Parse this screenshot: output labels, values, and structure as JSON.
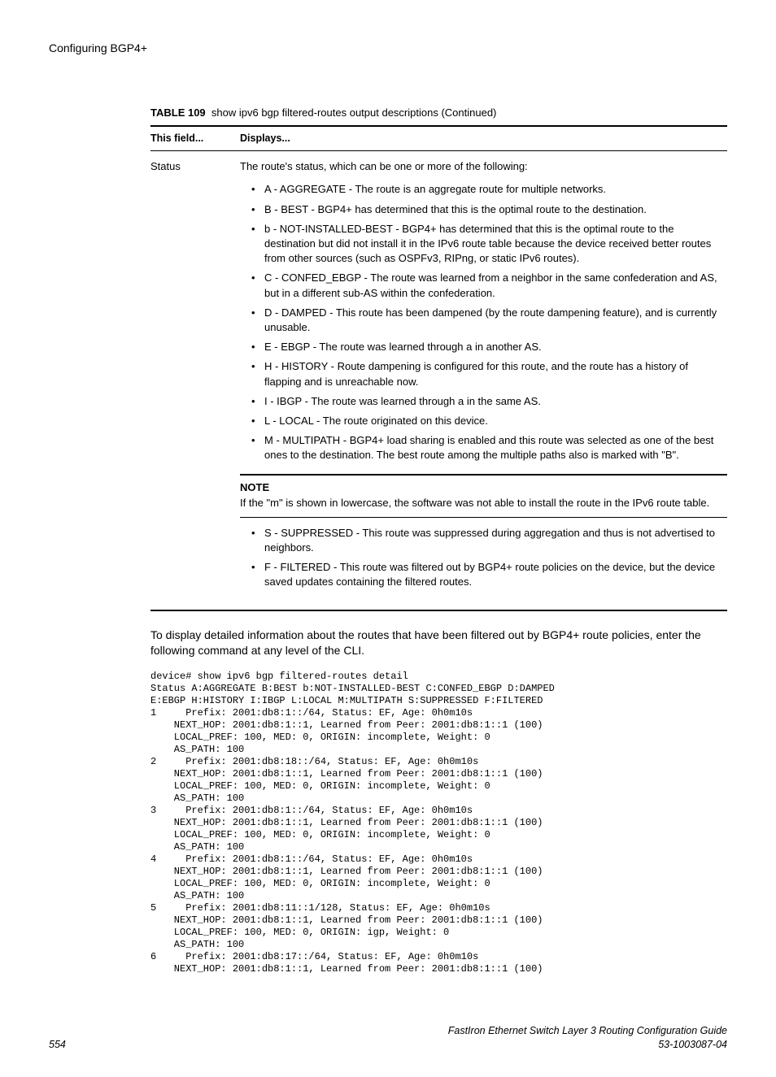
{
  "header": {
    "title": "Configuring BGP4+"
  },
  "table": {
    "caption_label": "TABLE 109",
    "caption_text": "show ipv6 bgp filtered-routes output descriptions (Continued)",
    "col1": "This field...",
    "col2": "Displays...",
    "row_field": "Status",
    "row_intro": "The route's status, which can be one or more of the following:",
    "bullets1": [
      "A - AGGREGATE - The route is an aggregate route for multiple networks.",
      "B - BEST - BGP4+ has determined that this is the optimal route to the destination.",
      "b - NOT-INSTALLED-BEST - BGP4+ has determined that this is the optimal route to the destination but did not install it in the IPv6 route table because the device received better routes from other sources (such as OSPFv3, RIPng, or static IPv6 routes).",
      "C - CONFED_EBGP - The route was learned from a neighbor in the same confederation and AS, but in a different sub-AS within the confederation.",
      "D - DAMPED - This route has been dampened (by the route dampening feature), and is currently unusable.",
      "E - EBGP - The route was learned through a in another AS.",
      "H - HISTORY - Route dampening is configured for this route, and the route has a history of flapping and is unreachable now.",
      "I - IBGP - The route was learned through a in the same AS.",
      "L - LOCAL - The route originated on this device.",
      "M - MULTIPATH - BGP4+ load sharing is enabled and this route was selected as one of the best ones to the destination. The best route among the multiple paths also is marked with \"B\"."
    ],
    "note_label": "NOTE",
    "note_text": "If the \"m\" is shown in lowercase, the software was not able to install the route in the IPv6 route table.",
    "bullets2": [
      "S - SUPPRESSED - This route was suppressed during aggregation and thus is not advertised to neighbors.",
      "F - FILTERED - This route was filtered out by BGP4+ route policies on the device, but the device saved updates containing the filtered routes."
    ]
  },
  "body_paragraph": "To display detailed information about the routes that have been filtered out by BGP4+ route policies, enter the following command at any level of the CLI.",
  "cli_output": "device# show ipv6 bgp filtered-routes detail\nStatus A:AGGREGATE B:BEST b:NOT-INSTALLED-BEST C:CONFED_EBGP D:DAMPED\nE:EBGP H:HISTORY I:IBGP L:LOCAL M:MULTIPATH S:SUPPRESSED F:FILTERED\n1     Prefix: 2001:db8:1::/64, Status: EF, Age: 0h0m10s\n    NEXT_HOP: 2001:db8:1::1, Learned from Peer: 2001:db8:1::1 (100)\n    LOCAL_PREF: 100, MED: 0, ORIGIN: incomplete, Weight: 0\n    AS_PATH: 100\n2     Prefix: 2001:db8:18::/64, Status: EF, Age: 0h0m10s\n    NEXT_HOP: 2001:db8:1::1, Learned from Peer: 2001:db8:1::1 (100)\n    LOCAL_PREF: 100, MED: 0, ORIGIN: incomplete, Weight: 0\n    AS_PATH: 100\n3     Prefix: 2001:db8:1::/64, Status: EF, Age: 0h0m10s\n    NEXT_HOP: 2001:db8:1::1, Learned from Peer: 2001:db8:1::1 (100)\n    LOCAL_PREF: 100, MED: 0, ORIGIN: incomplete, Weight: 0\n    AS_PATH: 100\n4     Prefix: 2001:db8:1::/64, Status: EF, Age: 0h0m10s\n    NEXT_HOP: 2001:db8:1::1, Learned from Peer: 2001:db8:1::1 (100)\n    LOCAL_PREF: 100, MED: 0, ORIGIN: incomplete, Weight: 0\n    AS_PATH: 100\n5     Prefix: 2001:db8:11::1/128, Status: EF, Age: 0h0m10s\n    NEXT_HOP: 2001:db8:1::1, Learned from Peer: 2001:db8:1::1 (100)\n    LOCAL_PREF: 100, MED: 0, ORIGIN: igp, Weight: 0\n    AS_PATH: 100\n6     Prefix: 2001:db8:17::/64, Status: EF, Age: 0h0m10s\n    NEXT_HOP: 2001:db8:1::1, Learned from Peer: 2001:db8:1::1 (100)",
  "footer": {
    "page": "554",
    "guide": "FastIron Ethernet Switch Layer 3 Routing Configuration Guide",
    "docnum": "53-1003087-04"
  }
}
